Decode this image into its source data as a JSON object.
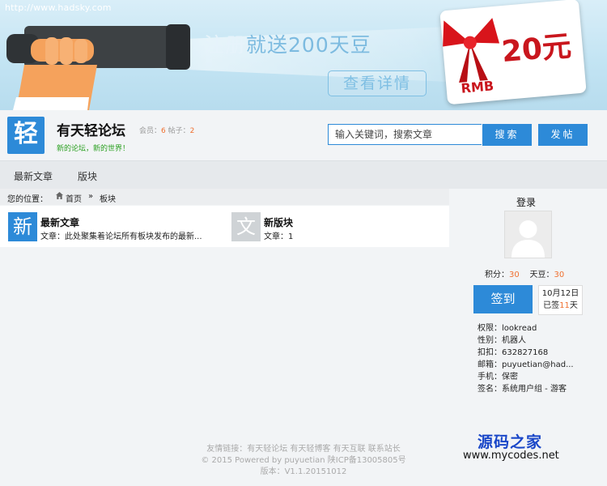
{
  "banner": {
    "url": "http://www.hadsky.com",
    "promo_faded": "注册",
    "promo_main": "就送200天豆",
    "detail_button": "查看详情",
    "card_value": "20元",
    "card_currency": "RMB"
  },
  "header": {
    "logo_char": "轻",
    "site_title": "有天轻论坛",
    "members_label": "会员：",
    "members_count": "6",
    "posts_label": "帖子：",
    "posts_count": "2",
    "slogan": "新的论坛，新的世界！",
    "search_placeholder": "输入关键词，搜索文章",
    "search_button": "搜索",
    "post_button": "发帖"
  },
  "nav": {
    "items": [
      {
        "label": "最新文章"
      },
      {
        "label": "版块"
      }
    ]
  },
  "breadcrumb": {
    "prefix": "您的位置：",
    "home": "首页",
    "separator": "»",
    "current": "板块"
  },
  "boards": [
    {
      "icon_char": "新",
      "name": "最新文章",
      "desc": "文章：此处聚集着论坛所有板块发布的最新...",
      "icon_color": "#2d8ad8"
    },
    {
      "icon_char": "文",
      "name": "新版块",
      "desc": "文章：1",
      "icon_color": "#cfd3d6"
    }
  ],
  "sidebar": {
    "login": "登录",
    "points_label": "积分：",
    "points_value": "30",
    "beans_label": "天豆：",
    "beans_value": "30",
    "sign_button": "签到",
    "sign_date": "10月12日",
    "signed_prefix": "已签",
    "signed_count": "11",
    "signed_suffix": "天",
    "info": [
      "权限：lookread",
      "性别：机器人",
      "扣扣：632827168",
      "邮箱：puyuetian@had...",
      "手机：保密",
      "签名：系统用户组 - 游客"
    ]
  },
  "footer": {
    "links": "友情链接：有天轻论坛 有天轻博客 有天互联 联系站长",
    "copyright": "© 2015 Powered by puyuetian 陕ICP备13005805号",
    "version": "版本：V1.1.20151012"
  },
  "watermark": {
    "name": "源码之家",
    "url": "www.mycodes.net"
  },
  "colors": {
    "accent": "#2d8ad8",
    "highlight": "#f07030",
    "slogan": "#2aa020"
  }
}
